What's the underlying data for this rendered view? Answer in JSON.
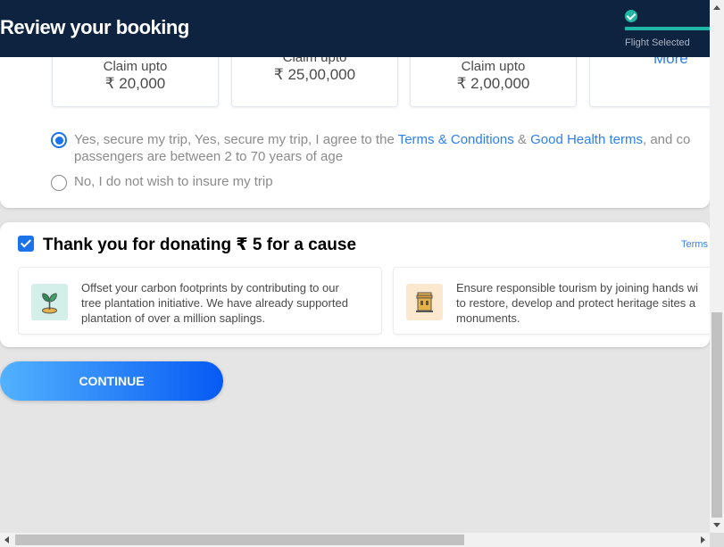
{
  "header": {
    "title": "Review your booking",
    "progress_step_label": "Flight Selected",
    "accent_color": "#1fb6a6",
    "background_color": "#0e2340"
  },
  "insurance": {
    "claims": [
      {
        "label": "Claim upto",
        "amount": "₹ 20,000"
      },
      {
        "label": "Claim upto",
        "amount": "₹ 25,00,000"
      },
      {
        "label": "Claim upto",
        "amount": "₹ 2,00,000"
      }
    ],
    "more_link": "More",
    "yes_option": {
      "prefix": "Yes, secure my trip, Yes, secure my trip, I agree to the ",
      "terms_link": "Terms & Conditions",
      "joiner": " & ",
      "health_link": "Good Health terms",
      "suffix": ", and co",
      "line2": "passengers are between 2 to 70 years of age",
      "selected": true
    },
    "no_option": {
      "label": "No, I do not wish to insure my trip",
      "selected": false
    }
  },
  "donation": {
    "checked": true,
    "title": "Thank you for donating ₹ 5 for a cause",
    "terms_link": "Terms",
    "causes": [
      {
        "icon": "plant-sapling-icon",
        "text": "Offset your carbon footprints by contributing to our\ntree plantation initiative. We have already supported\nplantation of over a million saplings."
      },
      {
        "icon": "heritage-monument-icon",
        "text": "Ensure responsible tourism by joining hands wi\nto restore, develop and protect heritage sites a\nmonuments."
      }
    ]
  },
  "continue_button": {
    "label": "CONTINUE"
  }
}
